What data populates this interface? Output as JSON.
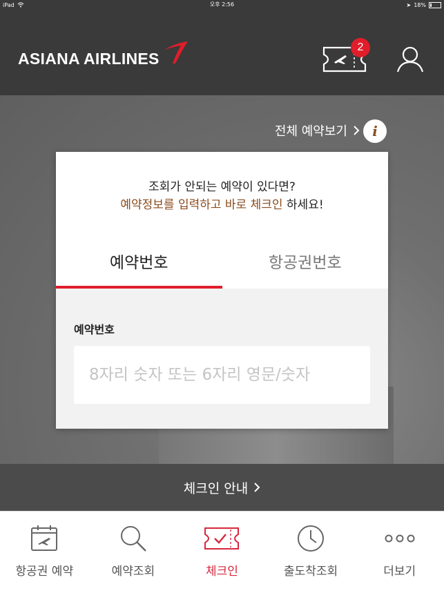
{
  "status_bar": {
    "device": "iPad",
    "time": "오후 2:56",
    "battery": "18%",
    "battery_level": 0.18
  },
  "header": {
    "logo_text": "ASIANA AIRLINES",
    "ticket_badge_count": "2",
    "icons": [
      "boarding-pass-icon",
      "user-icon"
    ]
  },
  "links": {
    "view_all_reservations": "전체 예약보기",
    "checkin_guide": "체크인 안내"
  },
  "card": {
    "message_line1": "조회가 안되는 예약이 있다면?",
    "message_line2_highlight": "예약정보를 입력하고 바로 체크인",
    "message_line2_rest": " 하세요!",
    "tabs": [
      {
        "label": "예약번호",
        "active": true
      },
      {
        "label": "항공권번호",
        "active": false
      }
    ],
    "field_label": "예약번호",
    "field_placeholder": "8자리 숫자 또는 6자리 영문/숫자",
    "field_value": ""
  },
  "tab_bar": {
    "items": [
      {
        "label": "항공권 예약",
        "icon": "calendar-plane-icon",
        "active": false
      },
      {
        "label": "예약조회",
        "icon": "search-icon",
        "active": false
      },
      {
        "label": "체크인",
        "icon": "ticket-check-icon",
        "active": true
      },
      {
        "label": "출도착조회",
        "icon": "clock-icon",
        "active": false
      },
      {
        "label": "더보기",
        "icon": "more-dots-icon",
        "active": false
      }
    ]
  },
  "colors": {
    "accent_red": "#e01d2b",
    "brown_highlight": "#8a4b1c",
    "header_bg": "#3a3a3a"
  }
}
